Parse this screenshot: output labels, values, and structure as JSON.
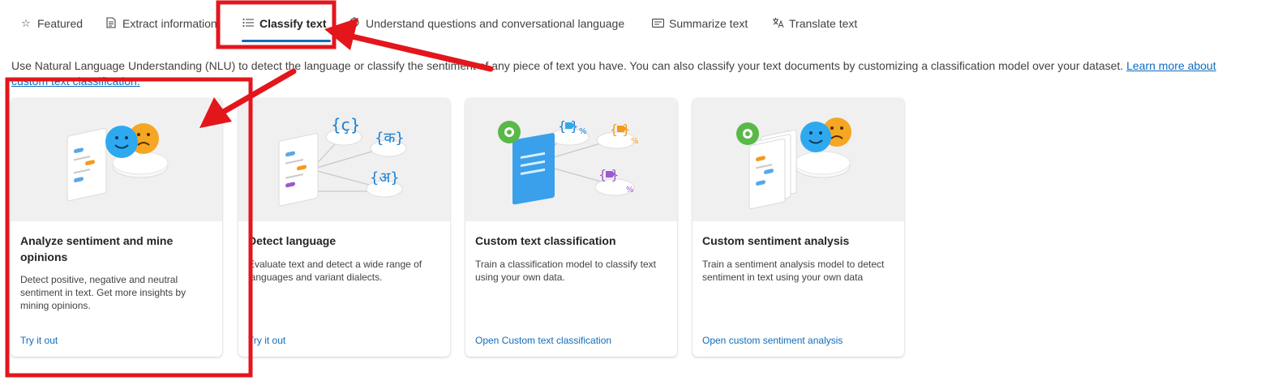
{
  "tabs": [
    {
      "label": "Featured",
      "icon": "star-icon"
    },
    {
      "label": "Extract information",
      "icon": "document-icon"
    },
    {
      "label": "Classify text",
      "icon": "list-icon",
      "active": true
    },
    {
      "label": "Understand questions and conversational language",
      "icon": "chat-icon"
    },
    {
      "label": "Summarize text",
      "icon": "summary-icon"
    },
    {
      "label": "Translate text",
      "icon": "translate-icon"
    }
  ],
  "description": {
    "text": "Use Natural Language Understanding (NLU) to detect the language or classify the sentiment of any piece of text you have. You can also classify your text documents by customizing a classification model over your dataset. ",
    "link": "Learn more about custom text classification."
  },
  "cards": [
    {
      "title": "Analyze sentiment and mine opinions",
      "body": "Detect positive, negative and neutral sentiment in text. Get more insights by mining opinions.",
      "link": "Try it out"
    },
    {
      "title": "Detect language",
      "body": "Evaluate text and detect a wide range of languages and variant dialects.",
      "link": "Try it out"
    },
    {
      "title": "Custom text classification",
      "body": "Train a classification model to classify text using your own data.",
      "link": "Open Custom text classification"
    },
    {
      "title": "Custom sentiment analysis",
      "body": "Train a sentiment analysis model to detect sentiment in text using your own data",
      "link": "Open custom sentiment analysis"
    }
  ],
  "hero_glyphs": {
    "g1": "{ç}",
    "g2": "{क}",
    "g3": "{अ}",
    "pct": "%"
  },
  "colors": {
    "accent": "#0f6cbd",
    "annotation": "#e3161c"
  }
}
